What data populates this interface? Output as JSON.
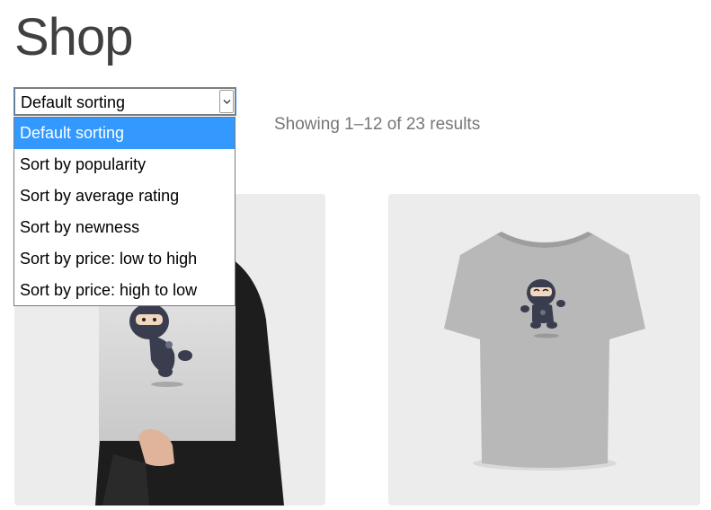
{
  "page": {
    "title": "Shop",
    "result_count": "Showing 1–12 of 23 results"
  },
  "sorting": {
    "selected_label": "Default sorting",
    "options": [
      {
        "label": "Default sorting",
        "selected": true
      },
      {
        "label": "Sort by popularity",
        "selected": false
      },
      {
        "label": "Sort by average rating",
        "selected": false
      },
      {
        "label": "Sort by newness",
        "selected": false
      },
      {
        "label": "Sort by price: low to high",
        "selected": false
      },
      {
        "label": "Sort by price: high to low",
        "selected": false
      }
    ]
  },
  "products": [
    {
      "image": "ninja-poster-image"
    },
    {
      "image": "ninja-tshirt-image"
    }
  ],
  "colors": {
    "highlight": "#3399ff",
    "card_background": "#ececec",
    "title_text": "#404040",
    "muted_text": "#767676"
  }
}
